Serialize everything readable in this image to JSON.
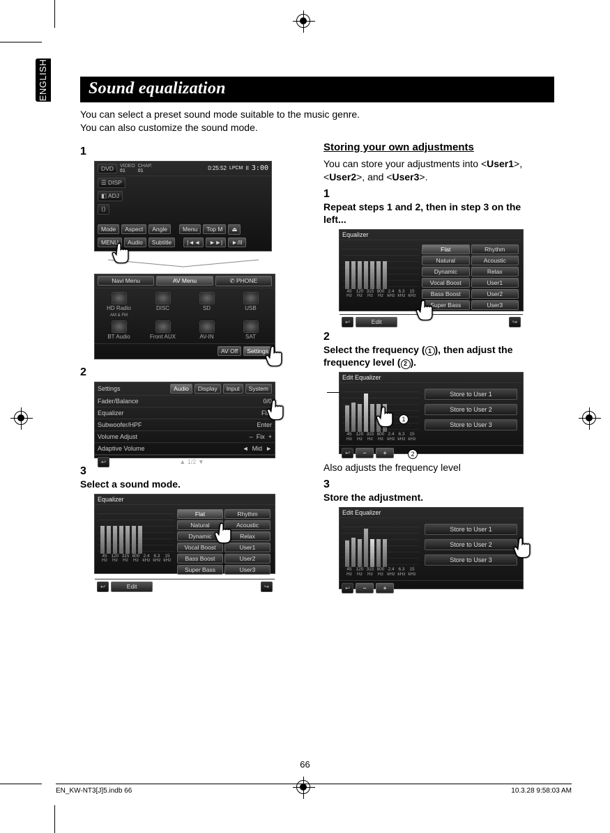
{
  "title": "Sound equalization",
  "language_tab": "ENGLISH",
  "intro": {
    "line1": "You can select a preset sound mode suitable to the music genre.",
    "line2": "You can also customize the sound mode."
  },
  "left": {
    "step1_num": "1",
    "step2_num": "2",
    "step3_num": "3",
    "step3_text": "Select a sound mode.",
    "shot1": {
      "source": "DVD",
      "video_lbl": "VIDEO",
      "video_val": "01",
      "chap_lbl": "CHAP.",
      "chap_val": "01",
      "time": "0:25:52",
      "lpcm": "LPCM",
      "pause": "II",
      "clock": "3:00",
      "btn_disp": "DISP",
      "btn_adj": "ADJ",
      "btn_mode": "Mode",
      "btn_aspect": "Aspect",
      "btn_angle": "Angle",
      "btn_menu": "Menu",
      "btn_topm": "Top M",
      "btn_eject": "⏏",
      "btn_menu2": "MENU",
      "btn_audio": "Audio",
      "btn_subtitle": "Subtitle",
      "btn_prev": "|◄◄",
      "btn_next": "►►|",
      "btn_play": "►/II"
    },
    "shot1b": {
      "tab_navi": "Navi Menu",
      "tab_av": "AV Menu",
      "tab_phone": "PHONE",
      "src_hdradio": "HD Radio",
      "src_amfm": "AM & FM",
      "src_disc": "DISC",
      "src_sd": "SD",
      "src_usb": "USB",
      "src_btaudio": "BT Audio",
      "src_frontaux": "Front AUX",
      "src_avin": "AV-IN",
      "src_sat": "SAT",
      "btn_avoff": "AV Off",
      "btn_settings": "Settings"
    },
    "shot2": {
      "title": "Settings",
      "tab_audio": "Audio",
      "tab_display": "Display",
      "tab_input": "Input",
      "tab_system": "System",
      "row_fader": "Fader/Balance",
      "row_fader_val": "0/0",
      "row_eq": "Equalizer",
      "row_eq_val": "Flat",
      "row_sub": "Subwoofer/HPF",
      "row_sub_val": "Enter",
      "row_vol": "Volume Adjust",
      "row_vol_val": "Fix",
      "row_adapt": "Adaptive Volume",
      "row_adapt_val": "Mid",
      "pager": "1/2"
    },
    "shot3": {
      "title": "Equalizer",
      "opt_flat": "Flat",
      "opt_rhythm": "Rhythm",
      "opt_natural": "Natural",
      "opt_acoustic": "Acoustic",
      "opt_dynamic": "Dynamic",
      "opt_relax": "Relax",
      "opt_vocal": "Vocal Boost",
      "opt_user1": "User1",
      "opt_bass": "Bass Boost",
      "opt_user2": "User2",
      "opt_super": "Super Bass",
      "opt_user3": "User3",
      "btn_edit": "Edit",
      "freqs": [
        "45\nHz",
        "120\nHz",
        "315\nHz",
        "800\nHz",
        "2.4\nkHz",
        "6.3\nkHz",
        "15\nkHz"
      ]
    }
  },
  "right": {
    "heading": "Storing your own adjustments",
    "intro_a": "You can store your adjustments into <",
    "intro_u1": "User1",
    "intro_b": ">, <",
    "intro_u2": "User2",
    "intro_c": ">, and <",
    "intro_u3": "User3",
    "intro_d": ">.",
    "step1_num": "1",
    "step1_text": "Repeat steps 1 and 2, then in step 3 on the left...",
    "step2_num": "2",
    "step2_text_a": "Select the frequency (",
    "step2_text_b": "), then adjust the frequency level (",
    "step2_text_c": ").",
    "callout1": "1",
    "callout2": "2",
    "also_adjusts": "Also adjusts the frequency level",
    "step3_num": "3",
    "step3_text": "Store the adjustment.",
    "shotR1": {
      "title": "Equalizer",
      "flat": "Flat",
      "rhythm": "Rhythm",
      "natural": "Natural",
      "acoustic": "Acoustic",
      "dynamic": "Dynamic",
      "relax": "Relax",
      "vocal": "Vocal Boost",
      "user1": "User1",
      "bass": "Bass Boost",
      "user2": "User2",
      "super": "Super Bass",
      "user3": "User3",
      "edit": "Edit",
      "freqs": [
        "45\nHz",
        "120\nHz",
        "315\nHz",
        "800\nHz",
        "2.4\nkHz",
        "6.3\nkHz",
        "15\nkHz"
      ]
    },
    "shotR2": {
      "title": "Edit Equalizer",
      "s1": "Store to User 1",
      "s2": "Store to User 2",
      "s3": "Store to User 3",
      "minus": "–",
      "plus": "+",
      "freqs": [
        "45\nHz",
        "120\nHz",
        "315\nHz",
        "800\nHz",
        "2.4\nkHz",
        "6.3\nkHz",
        "15\nkHz"
      ]
    },
    "shotR3": {
      "title": "Edit Equalizer",
      "s1": "Store to User 1",
      "s2": "Store to User 2",
      "s3": "Store to User 3",
      "minus": "–",
      "plus": "+",
      "freqs": [
        "45\nHz",
        "120\nHz",
        "315\nHz",
        "800\nHz",
        "2.4\nkHz",
        "6.3\nkHz",
        "15\nkHz"
      ]
    }
  },
  "page_number": "66",
  "footer": {
    "left": "EN_KW-NT3[J]5.indb   66",
    "right": "10.3.28   9:58:03 AM"
  }
}
